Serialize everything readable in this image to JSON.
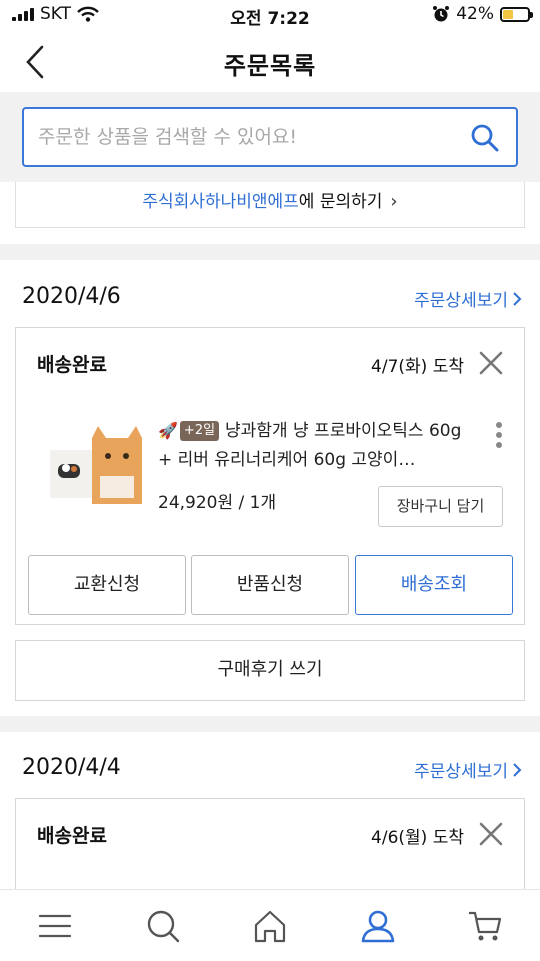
{
  "status_bar": {
    "carrier": "SKT",
    "time": "오전 7:22",
    "battery": "42%"
  },
  "header": {
    "title": "주문목록"
  },
  "search": {
    "placeholder": "주문한 상품을 검색할 수 있어요!"
  },
  "inquiry": {
    "seller_link": "주식회사하나비앤에프",
    "suffix": "에 문의하기"
  },
  "orders": [
    {
      "date": "2020/4/6",
      "detail_label": "주문상세보기",
      "status": "배송완료",
      "arrival": "4/7(화) 도착",
      "item": {
        "extra_badge": "+2일",
        "title": "냥과함개 냥 프로바이오틱스 60g + 리버 유리너리케어 60g 고양이…",
        "price_qty": "24,920원 / 1개",
        "cart_label": "장바구니 담기"
      },
      "actions": [
        "교환신청",
        "반품신청",
        "배송조회"
      ],
      "review_label": "구매후기 쓰기"
    },
    {
      "date": "2020/4/4",
      "detail_label": "주문상세보기",
      "status": "배송완료",
      "arrival": "4/6(월) 도착"
    }
  ],
  "bottom_nav": [
    "menu-icon",
    "search-icon",
    "home-icon",
    "my-page-icon",
    "cart-icon"
  ],
  "colors": {
    "accent": "#2f6fd4",
    "badge": "#7a6658",
    "band": "#f1f1f1"
  }
}
